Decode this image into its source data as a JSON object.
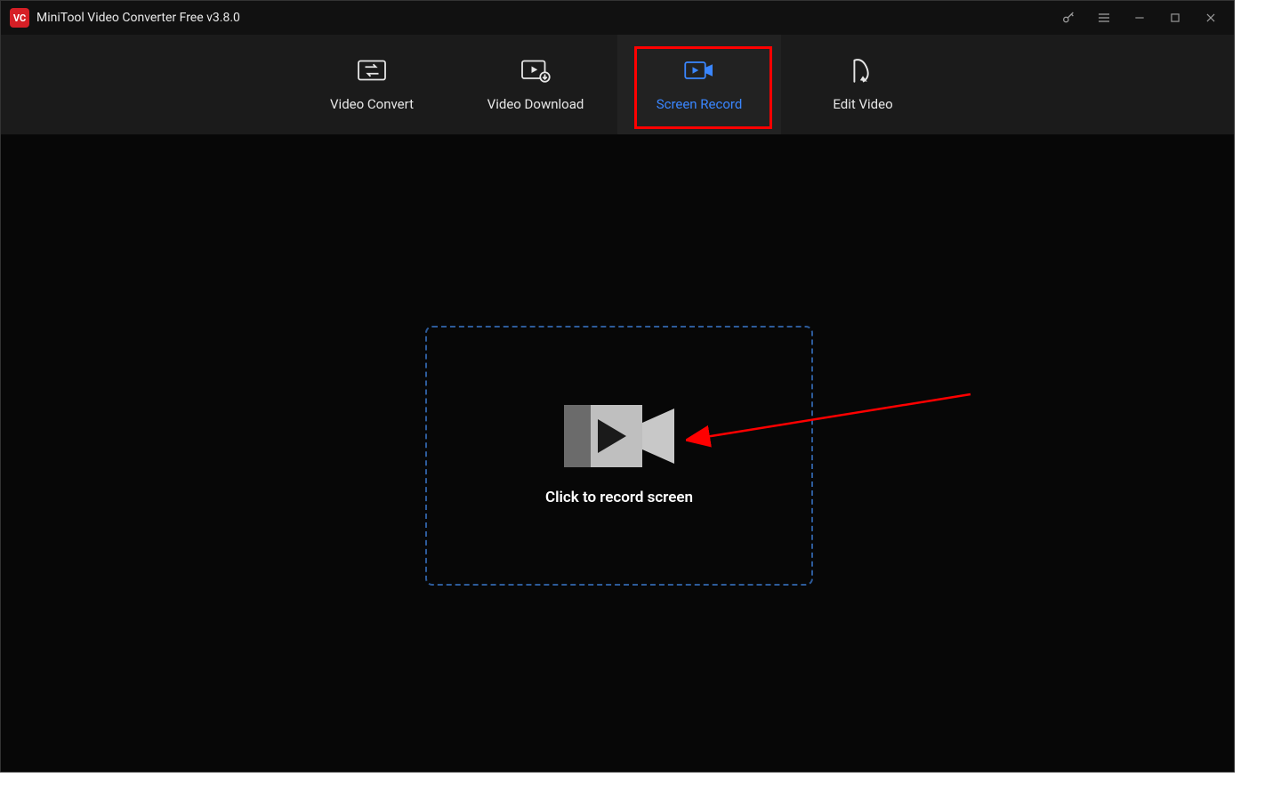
{
  "titlebar": {
    "app_logo_text": "VC",
    "title": "MiniTool Video Converter Free v3.8.0"
  },
  "tabs": {
    "items": [
      {
        "label": "Video Convert",
        "icon": "convert-icon"
      },
      {
        "label": "Video Download",
        "icon": "download-icon"
      },
      {
        "label": "Screen Record",
        "icon": "record-icon"
      },
      {
        "label": "Edit Video",
        "icon": "edit-icon"
      }
    ],
    "active_index": 2
  },
  "main": {
    "dropzone_label": "Click to record screen"
  },
  "colors": {
    "accent": "#3a86ff",
    "highlight": "#ff0000"
  }
}
